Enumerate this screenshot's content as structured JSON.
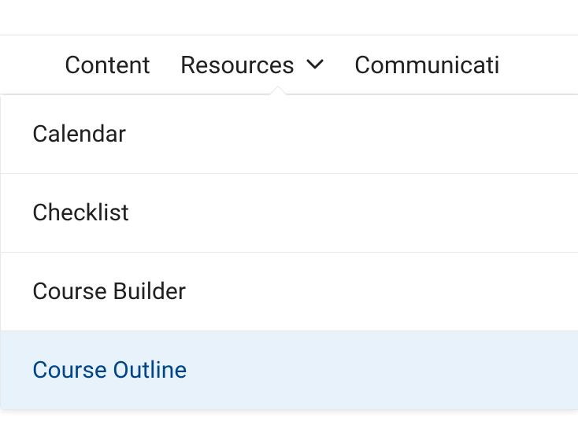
{
  "nav": {
    "items": [
      {
        "label": "Content",
        "hasDropdown": false
      },
      {
        "label": "Resources",
        "hasDropdown": true
      },
      {
        "label": "Communicati",
        "hasDropdown": false
      }
    ]
  },
  "dropdown": {
    "items": [
      {
        "label": "Calendar",
        "hovered": false
      },
      {
        "label": "Checklist",
        "hovered": false
      },
      {
        "label": "Course Builder",
        "hovered": false
      },
      {
        "label": "Course Outline",
        "hovered": true
      }
    ]
  }
}
